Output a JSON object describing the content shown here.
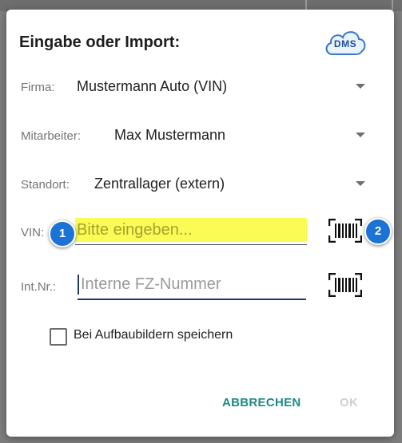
{
  "dialog": {
    "title": "Eingabe oder Import:",
    "logo_text": "DMS"
  },
  "fields": {
    "firma": {
      "label": "Firma:",
      "value": "Mustermann Auto (VIN)"
    },
    "mitarbeiter": {
      "label": "Mitarbeiter:",
      "value": "Max Mustermann"
    },
    "standort": {
      "label": "Standort:",
      "value": "Zentrallager (extern)"
    },
    "vin": {
      "label": "VIN:",
      "placeholder": "Bitte eingeben...",
      "value": ""
    },
    "intnr": {
      "label": "Int.Nr.:",
      "placeholder": "Interne FZ-Nummer",
      "value": ""
    }
  },
  "badges": {
    "first": "1",
    "second": "2"
  },
  "checkbox": {
    "label": "Bei Aufbaubildern speichern",
    "checked": false
  },
  "buttons": {
    "cancel": "ABBRECHEN",
    "ok": "OK"
  },
  "icons": {
    "dropdown": "caret-down-icon",
    "scanner": "barcode-scanner-icon",
    "logo": "cloud-dms-logo"
  },
  "colors": {
    "accent": "#1d8a85",
    "badge": "#1b73d6",
    "vin_highlight": "#fbfb55",
    "ok_disabled": "#cfcfcf"
  }
}
